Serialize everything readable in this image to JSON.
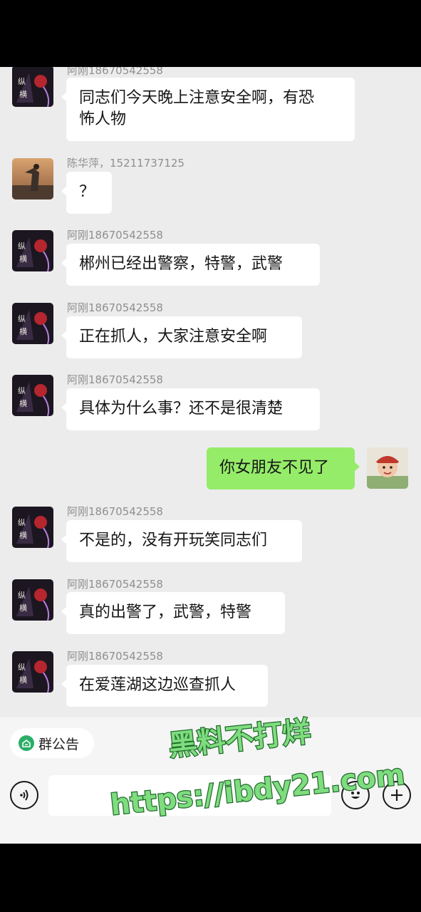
{
  "chat": {
    "messages": [
      {
        "side": "left",
        "avatar": "anime-avatar",
        "sender": "阿刚18670542558",
        "lines": [
          "同志们今天晚上注意安全啊，有恐",
          "怖人物"
        ]
      },
      {
        "side": "left",
        "avatar": "photo-avatar",
        "sender": "陈华萍，15211737125",
        "lines": [
          "？"
        ]
      },
      {
        "side": "left",
        "avatar": "anime-avatar",
        "sender": "阿刚18670542558",
        "lines": [
          "郴州已经出警察，特警，武警"
        ]
      },
      {
        "side": "left",
        "avatar": "anime-avatar",
        "sender": "阿刚18670542558",
        "lines": [
          "正在抓人，大家注意安全啊"
        ]
      },
      {
        "side": "left",
        "avatar": "anime-avatar",
        "sender": "阿刚18670542558",
        "lines": [
          "具体为什么事？还不是很清楚"
        ]
      },
      {
        "side": "right",
        "avatar": "self-avatar",
        "sender": "",
        "lines": [
          "你女朋友不见了"
        ]
      },
      {
        "side": "left",
        "avatar": "anime-avatar",
        "sender": "阿刚18670542558",
        "lines": [
          "不是的，没有开玩笑同志们"
        ]
      },
      {
        "side": "left",
        "avatar": "anime-avatar",
        "sender": "阿刚18670542558",
        "lines": [
          "真的出警了，武警，特警"
        ]
      },
      {
        "side": "left",
        "avatar": "anime-avatar",
        "sender": "阿刚18670542558",
        "lines": [
          "在爱莲湖这边巡查抓人"
        ]
      }
    ]
  },
  "input_bar": {
    "group_notice_label": "群公告",
    "voice_icon": "voice-icon",
    "emoji_icon": "emoji-icon",
    "plus_icon": "plus-icon",
    "message_value": ""
  },
  "watermark": {
    "line1": "黑料不打烊",
    "line2": "https://ibdy21.com"
  },
  "colors": {
    "chat_background": "#ececec",
    "self_bubble": "#95ec69",
    "other_bubble": "#ffffff",
    "watermark_fill": "#7fdc7f"
  }
}
